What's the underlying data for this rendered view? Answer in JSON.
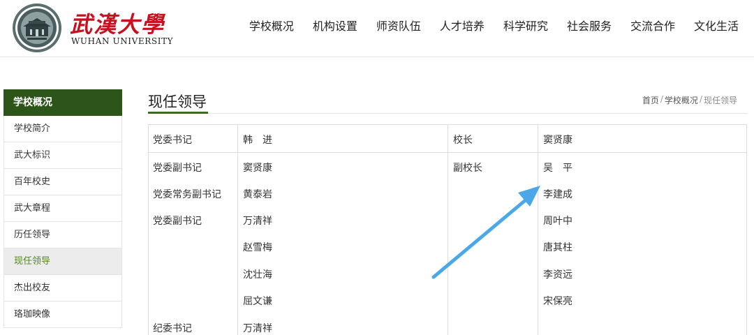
{
  "header": {
    "logo_cn": "武漢大學",
    "logo_en": "WUHAN UNIVERSITY",
    "nav": [
      "学校概况",
      "机构设置",
      "师资队伍",
      "人才培养",
      "科学研究",
      "社会服务",
      "交流合作",
      "文化生活"
    ]
  },
  "sidebar": {
    "title": "学校概况",
    "items": [
      "学校简介",
      "武大标识",
      "百年校史",
      "武大章程",
      "历任领导",
      "现任领导",
      "杰出校友",
      "珞珈映像"
    ],
    "active_index": 5
  },
  "main": {
    "title": "现任领导",
    "breadcrumb": [
      "首页",
      "学校概况",
      "现任领导"
    ]
  },
  "leaders": {
    "secretary_label": "党委书记",
    "secretary_name": "韩　进",
    "president_label": "校长",
    "president_name": "窦贤康",
    "deputy_secretary_label": "党委副书记",
    "deputy_secretary_name": "窦贤康",
    "standing_deputy_label": "党委常务副书记",
    "standing_deputy_name": "黄泰岩",
    "deputy_secretary_label_2": "党委副书记",
    "deputy_secretary_names": [
      "万清祥",
      "赵雪梅",
      "沈壮海",
      "屈文谦"
    ],
    "discipline_label": "纪委书记",
    "discipline_name": "万清祥",
    "vice_president_label": "副校长",
    "vice_presidents": [
      "吴　平",
      "李建成",
      "周叶中",
      "唐其柱",
      "李资远",
      "宋保亮"
    ]
  },
  "colors": {
    "brand_red": "#c8101f",
    "sidebar_green": "#2d5419",
    "active_green": "#52881e",
    "arrow_blue": "#4aa8e8"
  }
}
